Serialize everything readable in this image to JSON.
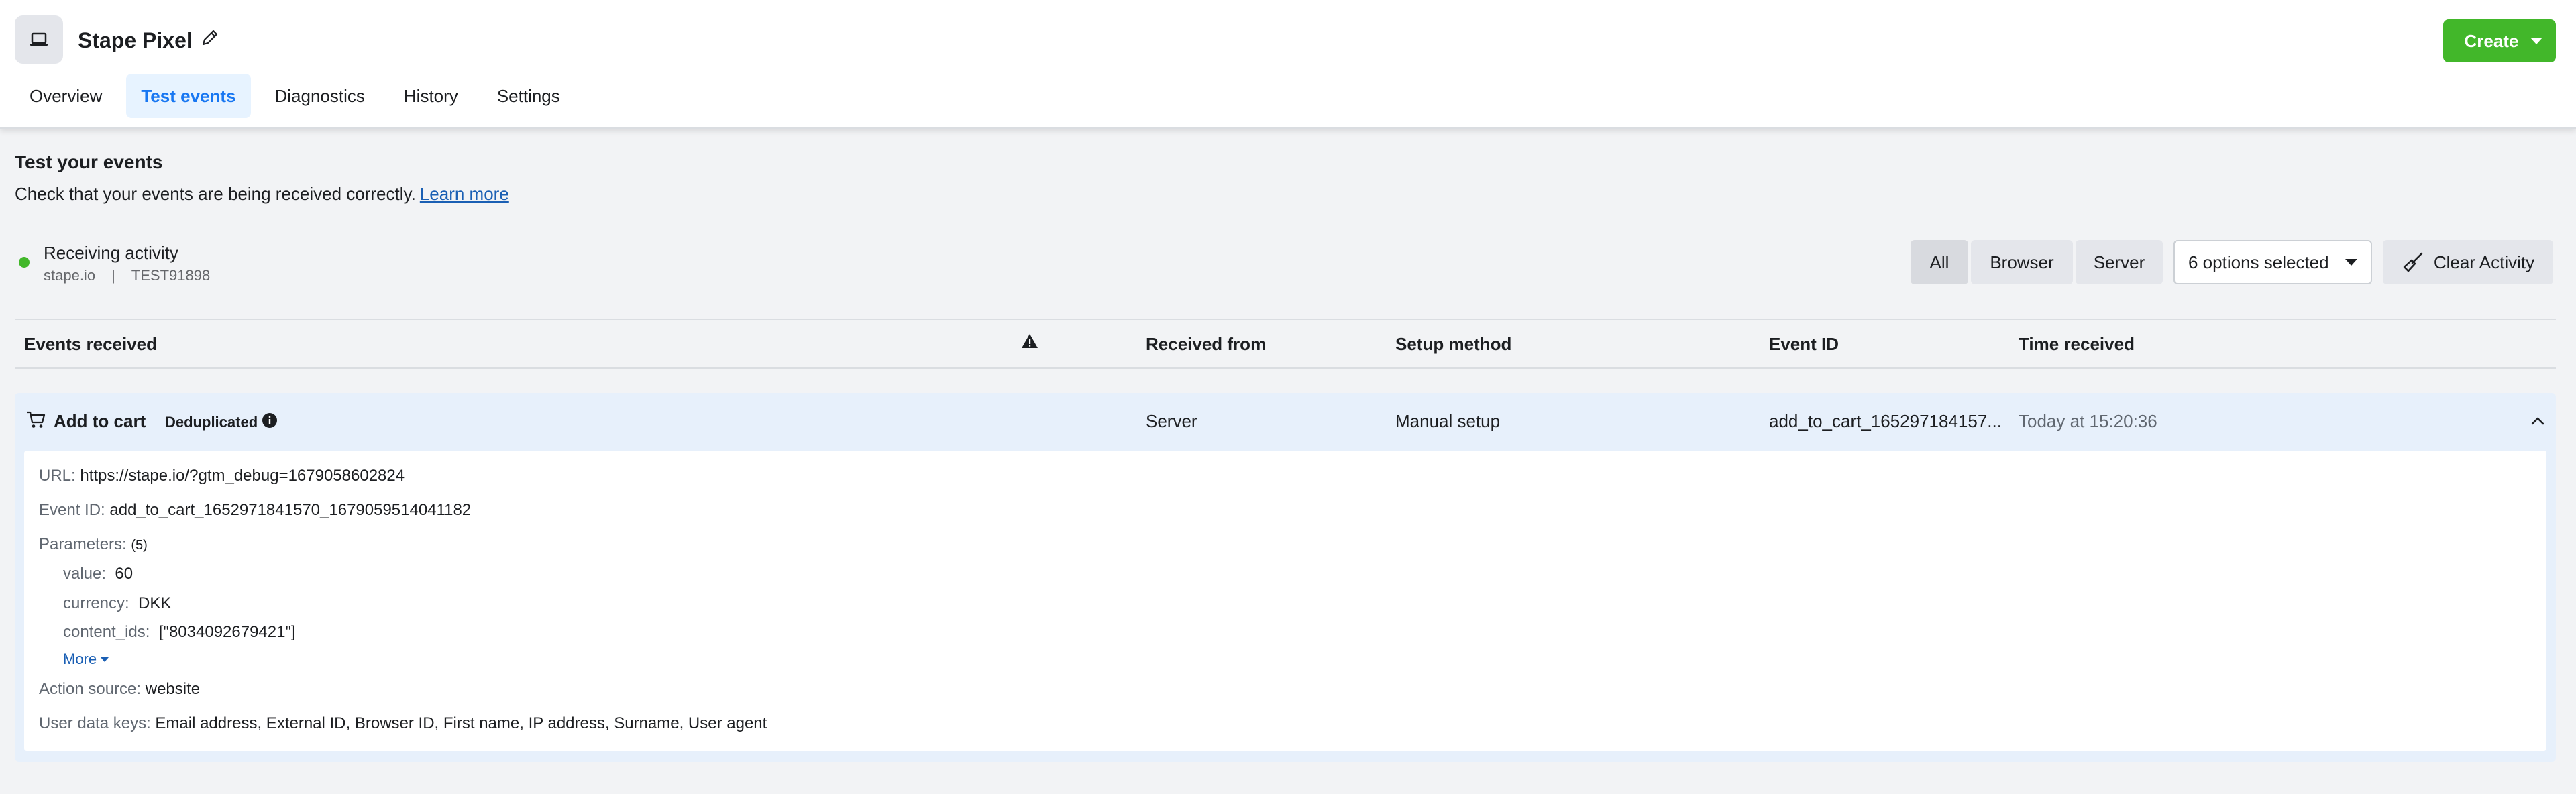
{
  "header": {
    "title": "Stape Pixel",
    "create_label": "Create",
    "tabs": [
      {
        "label": "Overview"
      },
      {
        "label": "Test events"
      },
      {
        "label": "Diagnostics"
      },
      {
        "label": "History"
      },
      {
        "label": "Settings"
      }
    ],
    "active_tab": "Test events"
  },
  "intro": {
    "title": "Test your events",
    "description": "Check that your events are being received correctly.",
    "learn_more": "Learn more"
  },
  "activity": {
    "status": "Receiving activity",
    "domain": "stape.io",
    "separator": "|",
    "test_code": "TEST91898",
    "status_color": "#42b72a"
  },
  "filters": {
    "all": "All",
    "browser": "Browser",
    "server": "Server",
    "selected": "All",
    "dropdown": "6 options selected",
    "clear": "Clear Activity"
  },
  "table": {
    "columns": {
      "events": "Events received",
      "received_from": "Received from",
      "setup_method": "Setup method",
      "event_id": "Event ID",
      "time": "Time received"
    },
    "rows": [
      {
        "event": "Add to cart",
        "badge": "Deduplicated",
        "received_from": "Server",
        "setup_method": "Manual setup",
        "event_id_short": "add_to_cart_165297184157...",
        "time": "Today at 15:20:36",
        "details": {
          "url_key": "URL:",
          "url": "https://stape.io/?gtm_debug=1679058602824",
          "event_id_key": "Event ID:",
          "event_id": "add_to_cart_1652971841570_1679059514041182",
          "params_key": "Parameters:",
          "params_count": "(5)",
          "params": [
            {
              "key": "value:",
              "value": "60"
            },
            {
              "key": "currency:",
              "value": "DKK"
            },
            {
              "key": "content_ids:",
              "value": "[\"8034092679421\"]"
            }
          ],
          "more": "More",
          "action_source_key": "Action source:",
          "action_source": "website",
          "user_data_key": "User data keys:",
          "user_data": "Email address, External ID, Browser ID, First name, IP address, Surname, User agent"
        }
      }
    ]
  },
  "colors": {
    "accent": "#1877f2",
    "create": "#42b72a",
    "row_highlight": "#e7f0fb",
    "link": "#1a5fb4"
  }
}
